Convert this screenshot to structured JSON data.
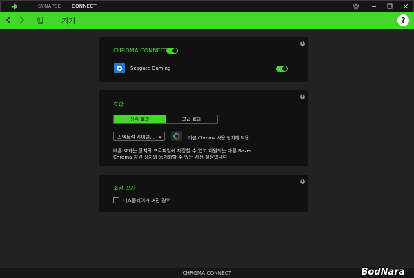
{
  "titlebar": {
    "tabs": [
      {
        "label": "SYNAPSE",
        "active": false
      },
      {
        "label": "CONNECT",
        "active": true
      }
    ],
    "buttons": [
      "settings-icon",
      "minimize-icon",
      "maximize-icon",
      "close-icon"
    ]
  },
  "navbar": {
    "tabs": [
      {
        "label": "앱",
        "active": false
      },
      {
        "label": "기기",
        "active": true
      }
    ],
    "help_label": "?"
  },
  "chroma_connect": {
    "title": "CHROMA CONNECT",
    "enabled": true,
    "app": {
      "name": "Seagate Gaming",
      "enabled": true
    }
  },
  "effects": {
    "title": "효과",
    "tabs": [
      {
        "label": "신속 효과",
        "active": true
      },
      {
        "label": "고급 효과",
        "active": false
      }
    ],
    "dropdown_value": "스펙트럼 사이클...",
    "apply_label": "다른 Chroma 사용 장치에 적용",
    "description_line1": "빠른 효과는 장치의 프로파일에 저장할 수 있고 지원되는 다른 Razer",
    "description_line2": "Chroma 지원 장치와 동기화할 수 있는 사전 설정입니다"
  },
  "lighting_off": {
    "title": "조명 끄기",
    "option_label": "디스플레이가 꺼진 경우",
    "checked": false
  },
  "bottom_bar": {
    "label": "CHROMA CONNECT"
  },
  "watermark": {
    "text": "BodNara"
  },
  "colors": {
    "accent": "#44d62c",
    "background": "#222222",
    "card": "#111111",
    "titlebar": "#151515"
  }
}
